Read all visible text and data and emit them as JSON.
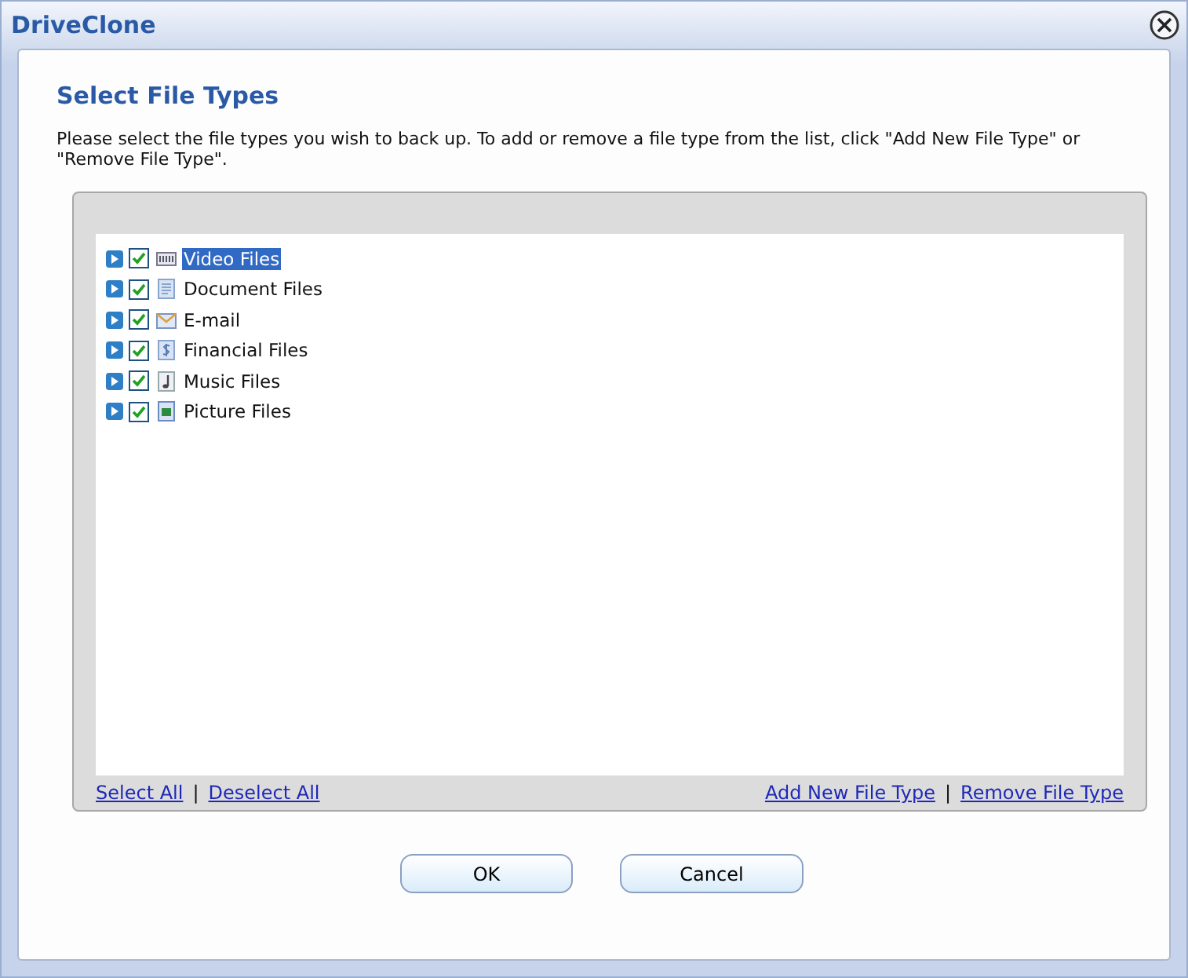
{
  "window": {
    "title": "DriveClone"
  },
  "heading": "Select File Types",
  "description": "Please select the file types you wish to back up. To add or remove a file type from the list, click \"Add New File Type\" or \"Remove File Type\".",
  "file_types": [
    {
      "label": "Video Files",
      "kind": "video",
      "checked": true,
      "selected": true
    },
    {
      "label": "Document Files",
      "kind": "document",
      "checked": true,
      "selected": false
    },
    {
      "label": "E-mail",
      "kind": "email",
      "checked": true,
      "selected": false
    },
    {
      "label": "Financial Files",
      "kind": "financial",
      "checked": true,
      "selected": false
    },
    {
      "label": "Music Files",
      "kind": "music",
      "checked": true,
      "selected": false
    },
    {
      "label": "Picture Files",
      "kind": "picture",
      "checked": true,
      "selected": false
    }
  ],
  "left_links": {
    "links": [
      "Select All",
      "Deselect All"
    ],
    "separator": "|"
  },
  "right_links": {
    "links": [
      "Add New File Type",
      "Remove File Type"
    ],
    "separator": "|"
  },
  "buttons": [
    "OK",
    "Cancel"
  ]
}
